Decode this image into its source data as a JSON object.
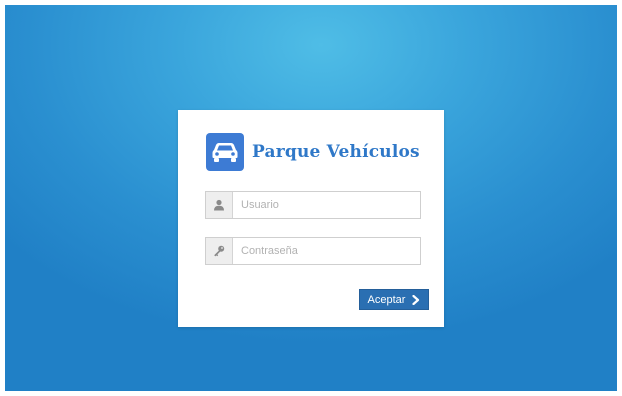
{
  "app": {
    "title": "Parque Vehículos",
    "logo_icon": "car-icon",
    "accent_color": "#3d7bd4",
    "title_color": "#2f78c8"
  },
  "login": {
    "username": {
      "icon": "user-icon",
      "placeholder": "Usuario",
      "value": ""
    },
    "password": {
      "icon": "key-icon",
      "placeholder": "Contraseña",
      "value": ""
    },
    "submit": {
      "label": "Aceptar",
      "icon": "chevron-right-icon",
      "color": "#2a6fb2"
    }
  }
}
